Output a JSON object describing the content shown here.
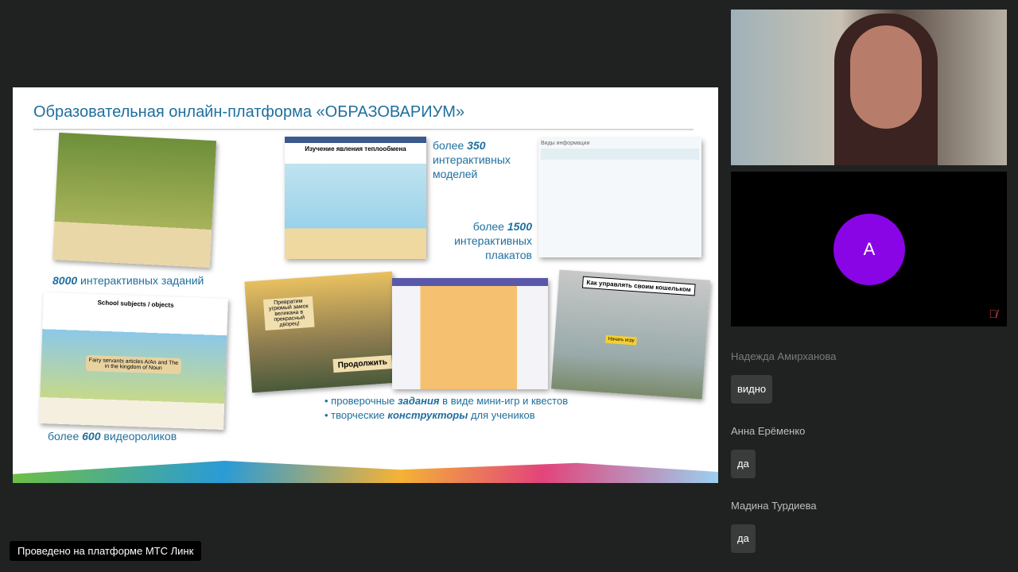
{
  "slide": {
    "title": "Образовательная онлайн-платформа «ОБРАЗОВАРИУМ»",
    "cap_tasks": {
      "num": "8000",
      "text": " интерактивных заданий"
    },
    "cap_models": {
      "pre": "более ",
      "num": "350",
      "l2": "интерактивных",
      "l3": "моделей"
    },
    "cap_posters": {
      "pre": "более ",
      "num": "1500",
      "l2": "интерактивных",
      "l3": "плакатов"
    },
    "cap_videos": {
      "pre": "более ",
      "num": "600",
      "text": " видеороликов"
    },
    "bullets": [
      {
        "pre": "проверочные ",
        "em": "задания",
        "post": " в виде мини-игр и квестов"
      },
      {
        "pre": "творческие ",
        "em": "конструкторы",
        "post": " для учеников"
      }
    ],
    "img_model_title": "Изучение явления теплообмена",
    "img_poster_title": "Виды информации",
    "img_video_title": "School subjects / objects",
    "img_video_banner": "Fairy servants articles A/An and The in the kingdom of Noun",
    "img_game_text": "Превратим угрюмый замок великана в прекрасный дворец!",
    "img_game_button": "Продолжить",
    "img_wallet_title": "Как управлять своим кошельком",
    "img_wallet_button": "Начать игру"
  },
  "participants": {
    "avatar_letter": "A"
  },
  "chat": [
    {
      "name": "Надежда Амирханова",
      "message": "видно"
    },
    {
      "name": "Анна Ерёменко",
      "message": "да"
    },
    {
      "name": "Мадина Турдиева",
      "message": "да"
    }
  ],
  "footer": "Проведено на платформе МТС Линк"
}
